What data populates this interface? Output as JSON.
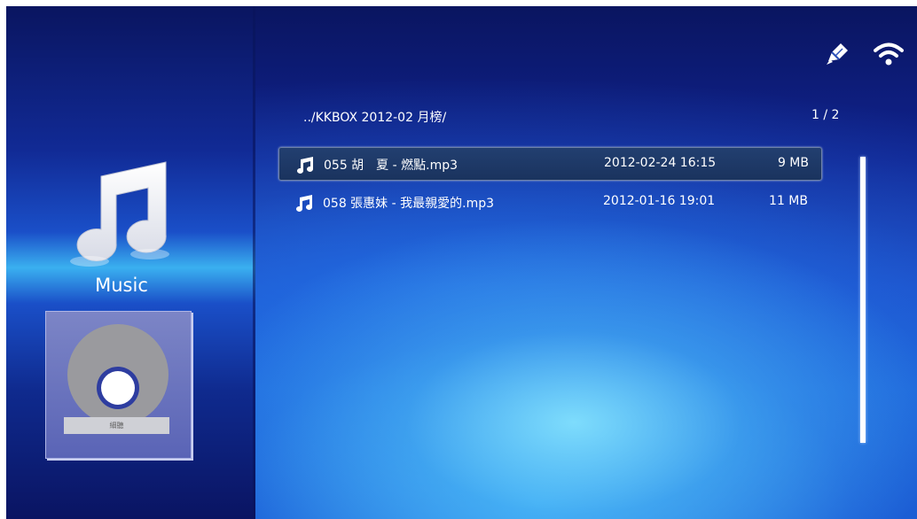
{
  "sidebar": {
    "category_label": "Music",
    "album_label": "細聽",
    "category_icon": "music-note-icon",
    "album_icon": "disc-icon"
  },
  "status": {
    "icons": [
      "usb-edit-icon",
      "wifi-icon"
    ]
  },
  "browser": {
    "path": "../KKBOX 2012-02 月榜/",
    "page": "1 / 2",
    "files": [
      {
        "name": "055 胡　夏 - 燃點.mp3",
        "date": "2012-02-24 16:15",
        "size": "9 MB",
        "selected": true
      },
      {
        "name": "058 張惠妹 - 我最親愛的.mp3",
        "date": "2012-01-16 19:01",
        "size": "11 MB",
        "selected": false
      }
    ]
  },
  "colors": {
    "selection": "#1a335e",
    "text": "#ffffff"
  }
}
